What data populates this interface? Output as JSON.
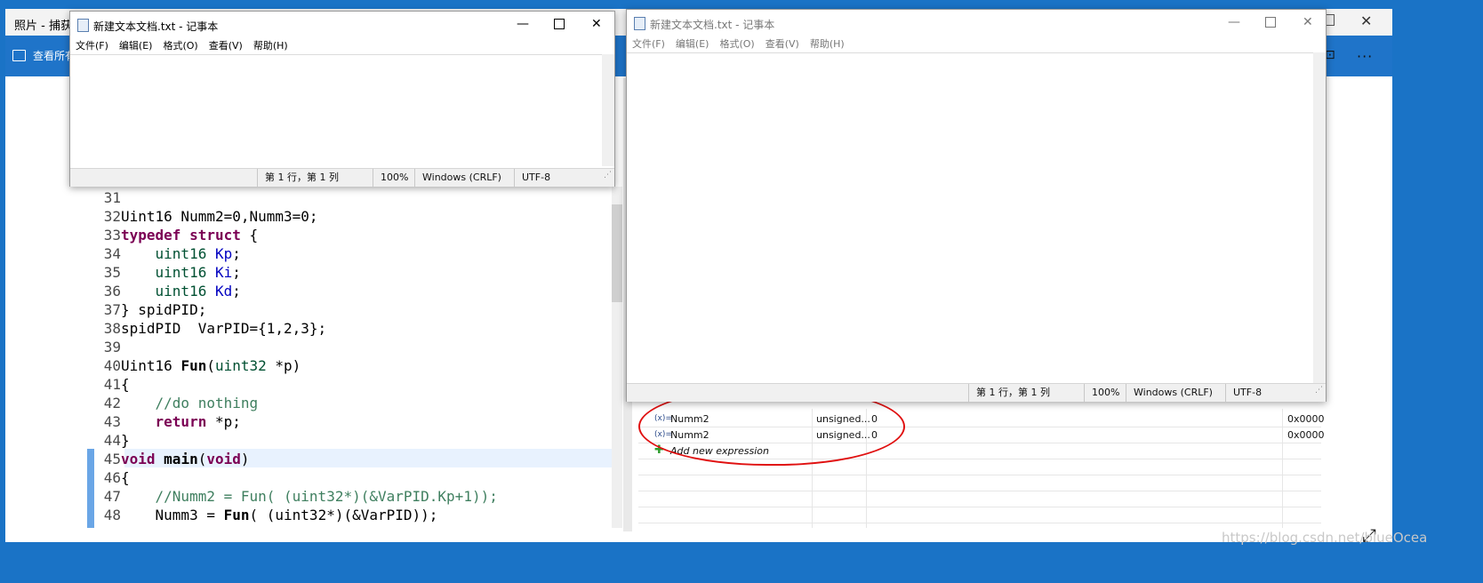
{
  "photos": {
    "title": "照片 - 捕获.P",
    "view_all": "查看所有",
    "watermark": "https://blog.csdn.net/blueOcea"
  },
  "notepad_left": {
    "title": "新建文本文档.txt - 记事本",
    "menu": [
      "文件(F)",
      "编辑(E)",
      "格式(O)",
      "查看(V)",
      "帮助(H)"
    ],
    "status": {
      "position": "第 1 行，第 1 列",
      "zoom": "100%",
      "eol": "Windows (CRLF)",
      "encoding": "UTF-8"
    }
  },
  "notepad_right": {
    "title": "新建文本文档.txt - 记事本",
    "menu": [
      "文件(F)",
      "编辑(E)",
      "格式(O)",
      "查看(V)",
      "帮助(H)"
    ],
    "status": {
      "position": "第 1 行，第 1 列",
      "zoom": "100%",
      "eol": "Windows (CRLF)",
      "encoding": "UTF-8"
    }
  },
  "code": {
    "lines": [
      {
        "n": "31",
        "t": ""
      },
      {
        "n": "32",
        "t": "Uint16 Numm2=0,Numm3=0;"
      },
      {
        "n": "33",
        "t": "typedef struct {"
      },
      {
        "n": "34",
        "t": "    uint16 Kp;"
      },
      {
        "n": "35",
        "t": "    uint16 Ki;"
      },
      {
        "n": "36",
        "t": "    uint16 Kd;"
      },
      {
        "n": "37",
        "t": "} spidPID;"
      },
      {
        "n": "38",
        "t": "spidPID  VarPID={1,2,3};"
      },
      {
        "n": "39",
        "t": ""
      },
      {
        "n": "40",
        "t": "Uint16 Fun(uint32 *p)"
      },
      {
        "n": "41",
        "t": "{"
      },
      {
        "n": "42",
        "t": "    //do nothing"
      },
      {
        "n": "43",
        "t": "    return *p;"
      },
      {
        "n": "44",
        "t": "}"
      },
      {
        "n": "45",
        "t": "void main(void)"
      },
      {
        "n": "46",
        "t": "{"
      },
      {
        "n": "47",
        "t": "    //Numm2 = Fun( (uint32*)(&VarPID.Kp+1));"
      },
      {
        "n": "48",
        "t": "    Numm3 = Fun( (uint32*)(&VarPID));"
      }
    ]
  },
  "expressions": {
    "rows": [
      {
        "name": "Numm2",
        "type": "unsigned...",
        "value": "0",
        "address": "0x0000"
      },
      {
        "name": "Numm2",
        "type": "unsigned...",
        "value": "0",
        "address": "0x0000"
      }
    ],
    "add_label": "Add new expression",
    "var_icon": "(x)="
  }
}
